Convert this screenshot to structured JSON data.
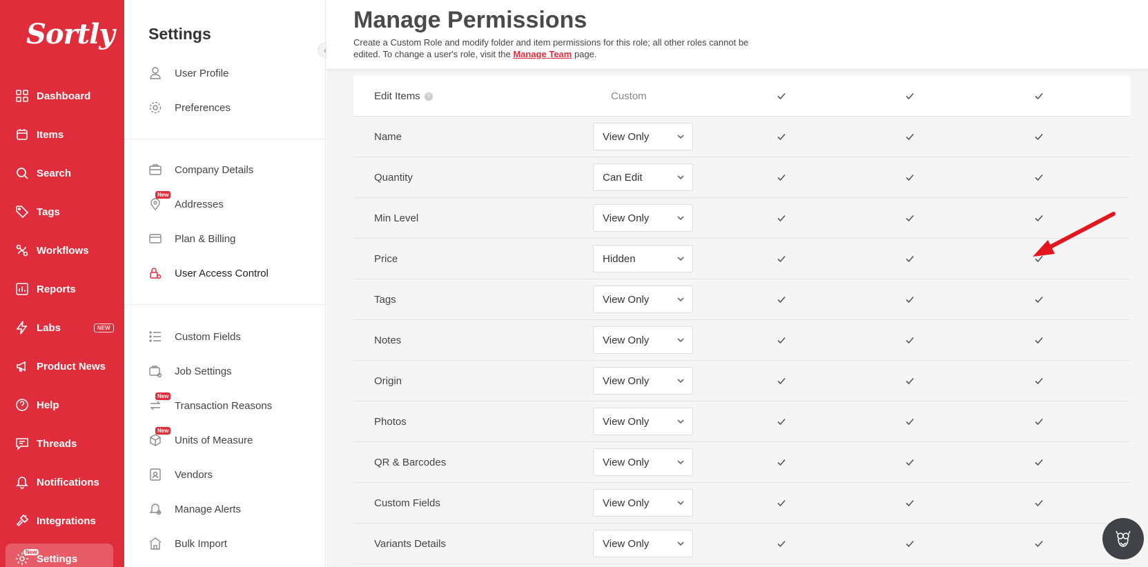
{
  "brand": {
    "logo": "Sortly",
    "accent": "#e02d3c"
  },
  "nav": {
    "items": [
      {
        "label": "Dashboard",
        "icon": "dashboard-icon"
      },
      {
        "label": "Items",
        "icon": "items-icon"
      },
      {
        "label": "Search",
        "icon": "search-icon"
      },
      {
        "label": "Tags",
        "icon": "tag-icon"
      },
      {
        "label": "Workflows",
        "icon": "workflows-icon"
      },
      {
        "label": "Reports",
        "icon": "reports-icon"
      },
      {
        "label": "Labs",
        "icon": "lightning-icon",
        "badge": "NEW"
      },
      {
        "label": "Product News",
        "icon": "megaphone-icon"
      },
      {
        "label": "Help",
        "icon": "help-icon"
      },
      {
        "label": "Threads",
        "icon": "threads-icon"
      },
      {
        "label": "Notifications",
        "icon": "bell-icon"
      },
      {
        "label": "Integrations",
        "icon": "plug-icon"
      },
      {
        "label": "Settings",
        "icon": "gear-icon",
        "badge": "New"
      }
    ]
  },
  "settings_sidebar": {
    "title": "Settings",
    "items": [
      {
        "label": "User Profile",
        "icon": "user-icon"
      },
      {
        "label": "Preferences",
        "icon": "gear-icon"
      },
      {
        "label": "Company Details",
        "icon": "briefcase-icon"
      },
      {
        "label": "Addresses",
        "icon": "location-icon",
        "badge": "New"
      },
      {
        "label": "Plan & Billing",
        "icon": "credit-card-icon"
      },
      {
        "label": "User Access Control",
        "icon": "user-lock-icon"
      },
      {
        "label": "Custom Fields",
        "icon": "list-icon"
      },
      {
        "label": "Job Settings",
        "icon": "job-settings-icon"
      },
      {
        "label": "Transaction Reasons",
        "icon": "transaction-icon",
        "badge": "New"
      },
      {
        "label": "Units of Measure",
        "icon": "units-icon",
        "badge": "New"
      },
      {
        "label": "Vendors",
        "icon": "vendor-icon"
      },
      {
        "label": "Manage Alerts",
        "icon": "alert-bell-icon"
      },
      {
        "label": "Bulk Import",
        "icon": "bulk-import-icon"
      }
    ]
  },
  "main": {
    "title": "Manage Permissions",
    "description_before": "Create a Custom Role and modify folder and item permissions for this role; all other roles cannot be edited. To change a user's role, visit the ",
    "description_link": "Manage Team",
    "description_after": " page.",
    "header_row": {
      "label": "Edit Items",
      "custom": "Custom"
    },
    "rows": [
      {
        "label": "Name",
        "value": "View Only"
      },
      {
        "label": "Quantity",
        "value": "Can Edit"
      },
      {
        "label": "Min Level",
        "value": "View Only"
      },
      {
        "label": "Price",
        "value": "Hidden"
      },
      {
        "label": "Tags",
        "value": "View Only"
      },
      {
        "label": "Notes",
        "value": "View Only"
      },
      {
        "label": "Origin",
        "value": "View Only"
      },
      {
        "label": "Photos",
        "value": "View Only"
      },
      {
        "label": "QR & Barcodes",
        "value": "View Only"
      },
      {
        "label": "Custom Fields",
        "value": "View Only"
      },
      {
        "label": "Variants Details",
        "value": "View Only"
      }
    ]
  }
}
